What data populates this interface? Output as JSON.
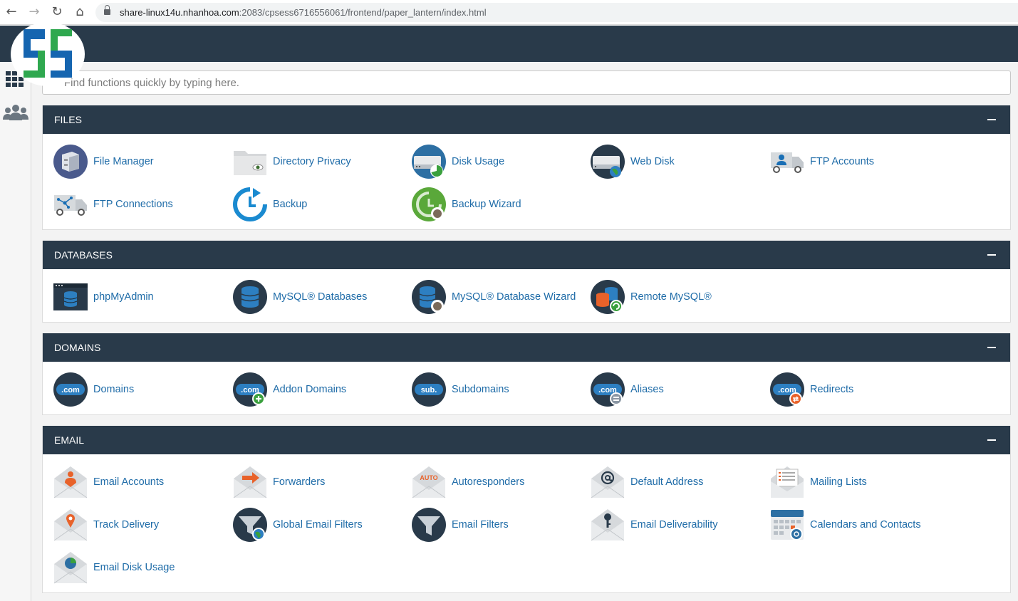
{
  "browser": {
    "url_host": "share-linux14u.nhanhoa.com",
    "url_rest": ":2083/cpsess6716556061/frontend/paper_lantern/index.html",
    "icons": [
      "back-arrow-icon",
      "forward-arrow-icon",
      "reload-icon",
      "home-icon",
      "lock-icon"
    ]
  },
  "search": {
    "placeholder": "Find functions quickly by typing here."
  },
  "colors": {
    "header": "#293a4a",
    "link": "#1f6ca8",
    "accent_blue": "#1a6fb5",
    "accent_green": "#3aa03d",
    "accent_orange": "#e8622a"
  },
  "sections": [
    {
      "title": "FILES",
      "items": [
        {
          "label": "File Manager",
          "icon": "file-manager-icon"
        },
        {
          "label": "Directory Privacy",
          "icon": "directory-privacy-icon"
        },
        {
          "label": "Disk Usage",
          "icon": "disk-usage-icon"
        },
        {
          "label": "Web Disk",
          "icon": "web-disk-icon"
        },
        {
          "label": "FTP Accounts",
          "icon": "ftp-accounts-icon"
        },
        {
          "label": "FTP Connections",
          "icon": "ftp-connections-icon"
        },
        {
          "label": "Backup",
          "icon": "backup-icon"
        },
        {
          "label": "Backup Wizard",
          "icon": "backup-wizard-icon"
        }
      ]
    },
    {
      "title": "DATABASES",
      "items": [
        {
          "label": "phpMyAdmin",
          "icon": "phpmyadmin-icon"
        },
        {
          "label": "MySQL® Databases",
          "icon": "mysql-databases-icon"
        },
        {
          "label": "MySQL® Database Wizard",
          "icon": "mysql-wizard-icon"
        },
        {
          "label": "Remote MySQL®",
          "icon": "remote-mysql-icon"
        }
      ]
    },
    {
      "title": "DOMAINS",
      "items": [
        {
          "label": "Domains",
          "icon": "domains-icon",
          "badge": ".com"
        },
        {
          "label": "Addon Domains",
          "icon": "addon-domains-icon",
          "badge": ".com"
        },
        {
          "label": "Subdomains",
          "icon": "subdomains-icon",
          "badge": "sub."
        },
        {
          "label": "Aliases",
          "icon": "aliases-icon",
          "badge": ".com"
        },
        {
          "label": "Redirects",
          "icon": "redirects-icon",
          "badge": ".com"
        }
      ]
    },
    {
      "title": "EMAIL",
      "items": [
        {
          "label": "Email Accounts",
          "icon": "email-accounts-icon"
        },
        {
          "label": "Forwarders",
          "icon": "forwarders-icon"
        },
        {
          "label": "Autoresponders",
          "icon": "autoresponders-icon",
          "badge": "AUTO"
        },
        {
          "label": "Default Address",
          "icon": "default-address-icon"
        },
        {
          "label": "Mailing Lists",
          "icon": "mailing-lists-icon"
        },
        {
          "label": "Track Delivery",
          "icon": "track-delivery-icon"
        },
        {
          "label": "Global Email Filters",
          "icon": "global-email-filters-icon"
        },
        {
          "label": "Email Filters",
          "icon": "email-filters-icon"
        },
        {
          "label": "Email Deliverability",
          "icon": "email-deliverability-icon"
        },
        {
          "label": "Calendars and Contacts",
          "icon": "calendars-contacts-icon"
        },
        {
          "label": "Email Disk Usage",
          "icon": "email-disk-usage-icon"
        }
      ]
    }
  ]
}
